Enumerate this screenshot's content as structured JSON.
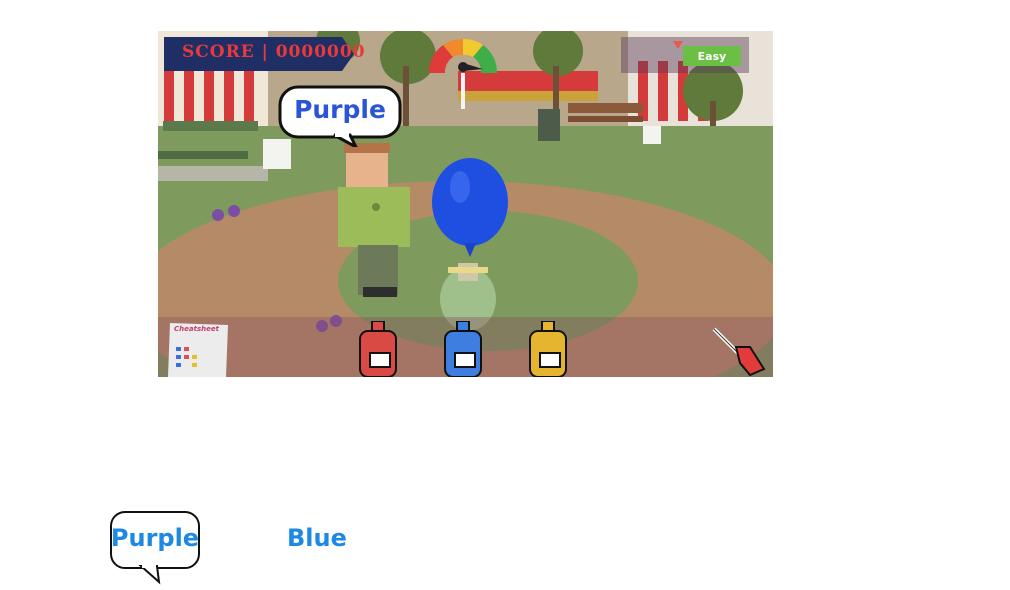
{
  "hud": {
    "score_label": "SCORE | 0000000",
    "difficulty": "Easy"
  },
  "speech_bubble": {
    "text": "Purple"
  },
  "cheatsheet": {
    "title": "Cheatsheet"
  },
  "paint_cans": [
    {
      "color_name": "red",
      "color": "#d94a45"
    },
    {
      "color_name": "blue",
      "color": "#3d7ee0"
    },
    {
      "color_name": "yellow",
      "color": "#e6b52f"
    }
  ],
  "balloon": {
    "color": "#1f4fe0"
  },
  "legend": {
    "target_label": "Purple",
    "answer_label": "Blue"
  }
}
